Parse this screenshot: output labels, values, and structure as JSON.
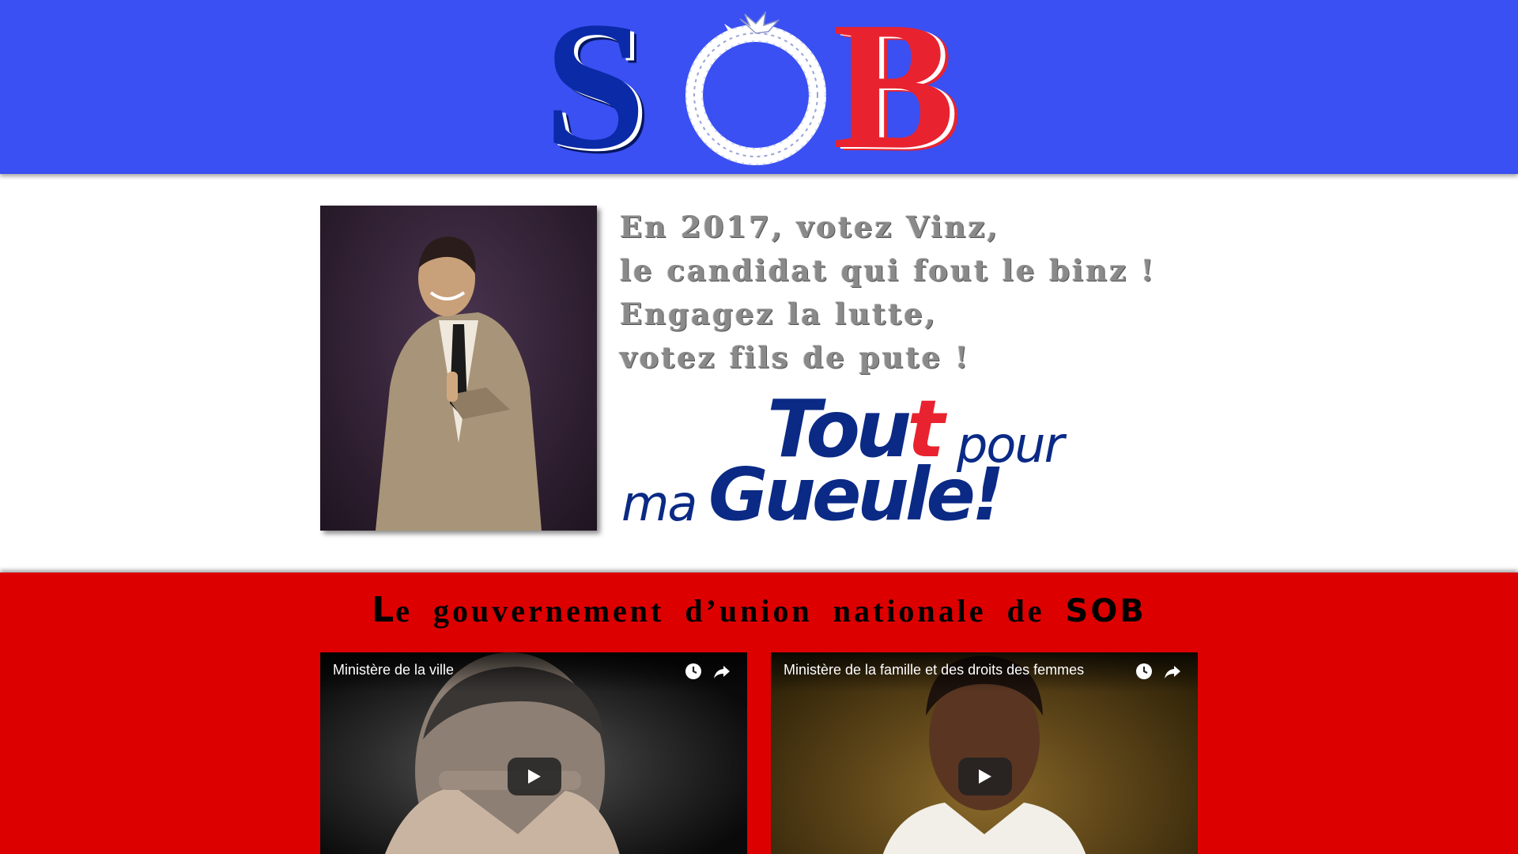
{
  "header": {
    "logo_text": "SOB",
    "logo_letters": [
      "S",
      "B"
    ],
    "brand_colors": {
      "band": "#3a50f2",
      "s_letter": "#0a2aa8",
      "b_letter": "#e8232f"
    }
  },
  "main": {
    "slogan_lines": [
      "En 2017, votez Vinz,",
      "le candidat qui fout le binz !",
      "Engagez la lutte,",
      "votez fils de pute !"
    ],
    "campaign_logo": {
      "tout": "Tou",
      "tout_red": "t",
      "pour": "pour",
      "ma": "ma",
      "gueule": "Gueule!"
    }
  },
  "government": {
    "title_first_letter": "L",
    "title_middle": "e gouvernement d’union nationale de ",
    "title_brand": "SOB",
    "band_color": "#dd0000"
  },
  "videos": [
    {
      "title": "Ministère de la ville",
      "watch_later_icon": "clock-icon",
      "share_icon": "share-arrow-icon",
      "play_icon": "play-icon"
    },
    {
      "title": "Ministère de la famille et des droits des femmes",
      "watch_later_icon": "clock-icon",
      "share_icon": "share-arrow-icon",
      "play_icon": "play-icon"
    }
  ]
}
